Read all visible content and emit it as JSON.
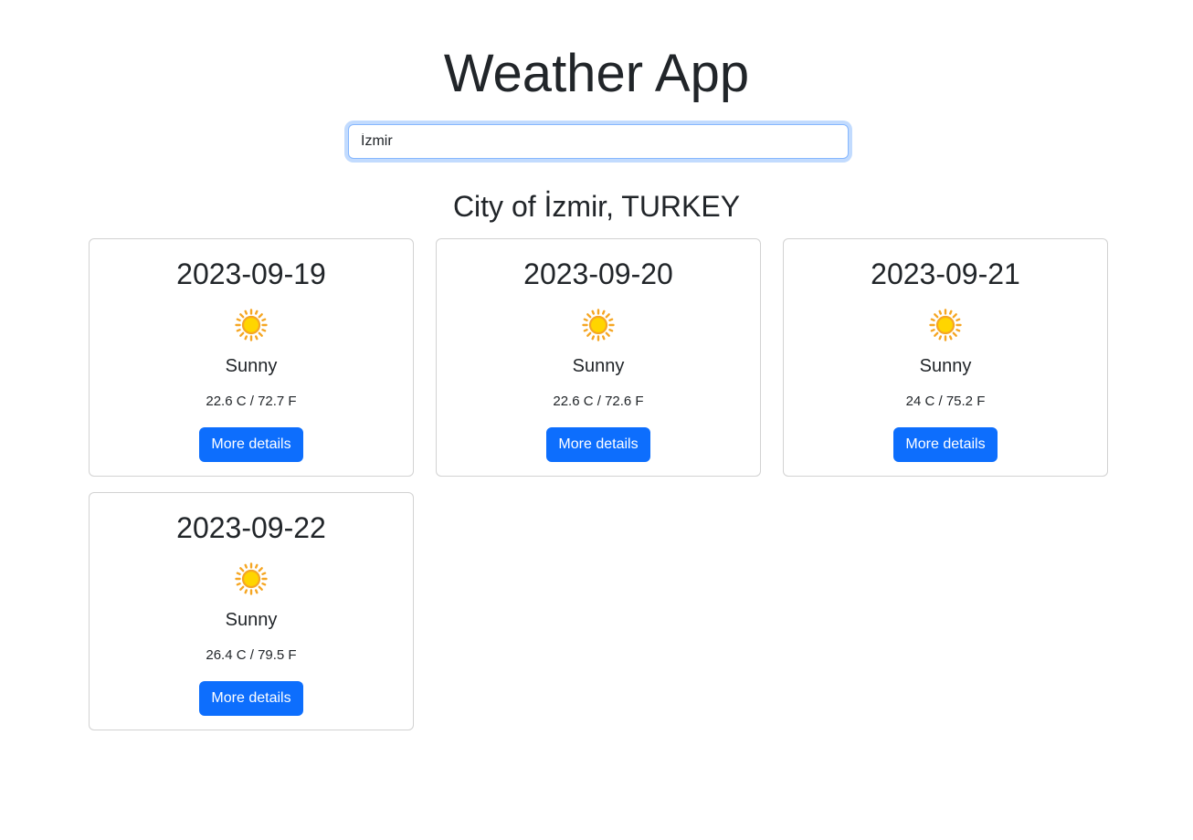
{
  "app": {
    "title": "Weather App"
  },
  "search": {
    "value": "İzmir",
    "placeholder": ""
  },
  "location": {
    "heading": "City of İzmir, TURKEY"
  },
  "forecast": [
    {
      "date": "2023-09-19",
      "icon": "sun-icon",
      "condition": "Sunny",
      "temperature": "22.6 C / 72.7 F",
      "button_label": "More details"
    },
    {
      "date": "2023-09-20",
      "icon": "sun-icon",
      "condition": "Sunny",
      "temperature": "22.6 C / 72.6 F",
      "button_label": "More details"
    },
    {
      "date": "2023-09-21",
      "icon": "sun-icon",
      "condition": "Sunny",
      "temperature": "24 C / 75.2 F",
      "button_label": "More details"
    },
    {
      "date": "2023-09-22",
      "icon": "sun-icon",
      "condition": "Sunny",
      "temperature": "26.4 C / 79.5 F",
      "button_label": "More details"
    }
  ],
  "colors": {
    "primary_button": "#0d6efd",
    "sun_fill": "#ffd500",
    "sun_rays": "#f5a623",
    "focus_border": "#86b7fe"
  }
}
